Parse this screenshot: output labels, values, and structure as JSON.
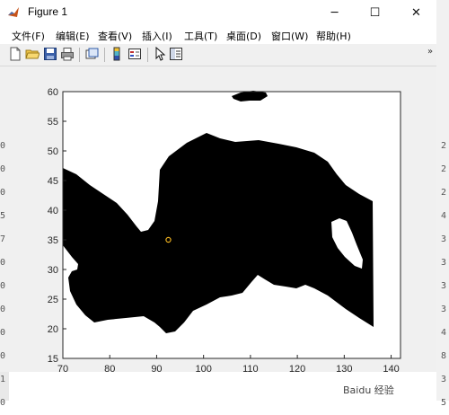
{
  "window": {
    "title": "Figure 1",
    "minimize_symbol": "─",
    "maximize_symbol": "☐",
    "close_symbol": "✕"
  },
  "menu": [
    {
      "label": "文件(F)"
    },
    {
      "label": "编辑(E)"
    },
    {
      "label": "查看(V)"
    },
    {
      "label": "插入(I)"
    },
    {
      "label": "工具(T)"
    },
    {
      "label": "桌面(D)"
    },
    {
      "label": "窗口(W)"
    },
    {
      "label": "帮助(H)"
    }
  ],
  "toolbar": {
    "icons": [
      "new-figure-icon",
      "open-file-icon",
      "save-icon",
      "print-icon",
      "link-plot-icon",
      "insert-colorbar-icon",
      "insert-legend-icon",
      "edit-plot-icon",
      "property-inspector-icon"
    ]
  },
  "chart_data": {
    "type": "scatter",
    "x_ticks": [
      "70",
      "80",
      "90",
      "100",
      "110",
      "120",
      "130",
      "140"
    ],
    "y_ticks": [
      "15",
      "20",
      "25",
      "30",
      "35",
      "40",
      "45",
      "50",
      "55",
      "60"
    ],
    "xlim": [
      70,
      142
    ],
    "ylim": [
      15,
      60
    ],
    "points": [
      {
        "x": 92.5,
        "y": 35
      }
    ],
    "marker_color": "#EDB120",
    "region_color": "#000000",
    "background_color": "#ffffff"
  },
  "background": {
    "left_digits": [
      "0",
      "0",
      "0",
      "5",
      "7",
      "0",
      "0",
      "0",
      "0",
      "0",
      "1",
      "0"
    ],
    "right_digits": [
      "2",
      "2",
      "2",
      "4",
      "3",
      "3",
      "3",
      "3",
      "4",
      "8",
      "3",
      "5"
    ]
  },
  "watermark": "Baidu 经验"
}
